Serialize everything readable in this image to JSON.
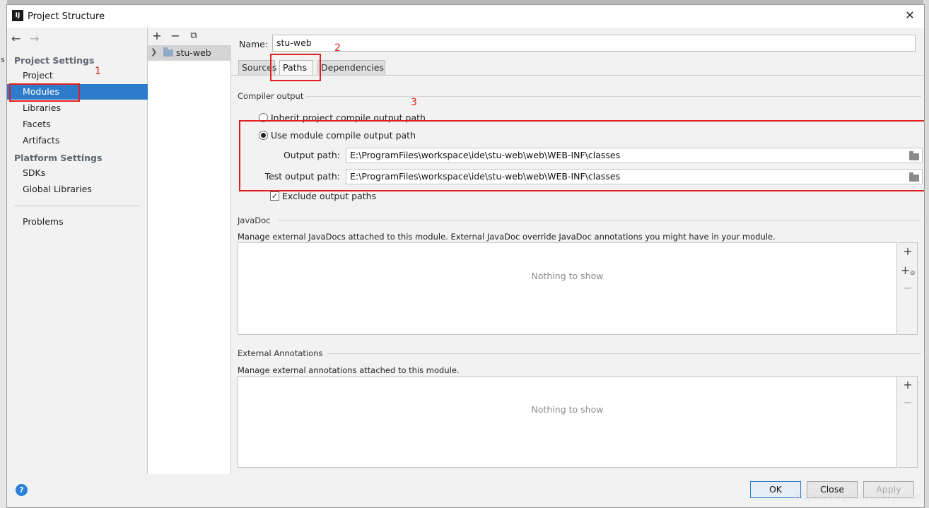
{
  "window": {
    "title": "Project Structure",
    "app_icon_text": "IJ"
  },
  "nav": {
    "project_settings_header": "Project Settings",
    "platform_settings_header": "Platform Settings",
    "items": {
      "project": "Project",
      "modules": "Modules",
      "libraries": "Libraries",
      "facets": "Facets",
      "artifacts": "Artifacts",
      "sdks": "SDKs",
      "global_libraries": "Global Libraries",
      "problems": "Problems"
    },
    "selected": "Modules"
  },
  "tree": {
    "toolbar": {
      "add": "+",
      "remove": "−",
      "copy": "⧉"
    },
    "items": [
      {
        "label": "stu-web"
      }
    ]
  },
  "module": {
    "name_label": "Name:",
    "name_value": "stu-web",
    "tabs": [
      "Sources",
      "Paths",
      "Dependencies"
    ],
    "active_tab": "Paths"
  },
  "compiler_output": {
    "title": "Compiler output",
    "inherit_label": "Inherit project compile output path",
    "use_module_label": "Use module compile output path",
    "selected_option": "use_module",
    "output_path_label": "Output path:",
    "output_path_value": "E:\\ProgramFiles\\workspace\\ide\\stu-web\\web\\WEB-INF\\classes",
    "test_output_path_label": "Test output path:",
    "test_output_path_value": "E:\\ProgramFiles\\workspace\\ide\\stu-web\\web\\WEB-INF\\classes",
    "exclude_label": "Exclude output paths",
    "exclude_checked": true
  },
  "javadoc": {
    "title": "JavaDoc",
    "description": "Manage external JavaDocs attached to this module. External JavaDoc override JavaDoc annotations you might have in your module.",
    "empty_text": "Nothing to show"
  },
  "external_annotations": {
    "title": "External Annotations",
    "description": "Manage external annotations attached to this module.",
    "empty_text": "Nothing to show"
  },
  "footer": {
    "help": "?",
    "ok": "OK",
    "close": "Close",
    "apply": "Apply"
  },
  "annotations": {
    "step1": "1",
    "step2": "2",
    "step3": "3",
    "color": "#e02020"
  },
  "watermark": "https://blog.csdn.net/javion",
  "background_fragments": [
    "s"
  ],
  "colors": {
    "selection": "#2d7ccb",
    "help_icon": "#2a82d8"
  }
}
